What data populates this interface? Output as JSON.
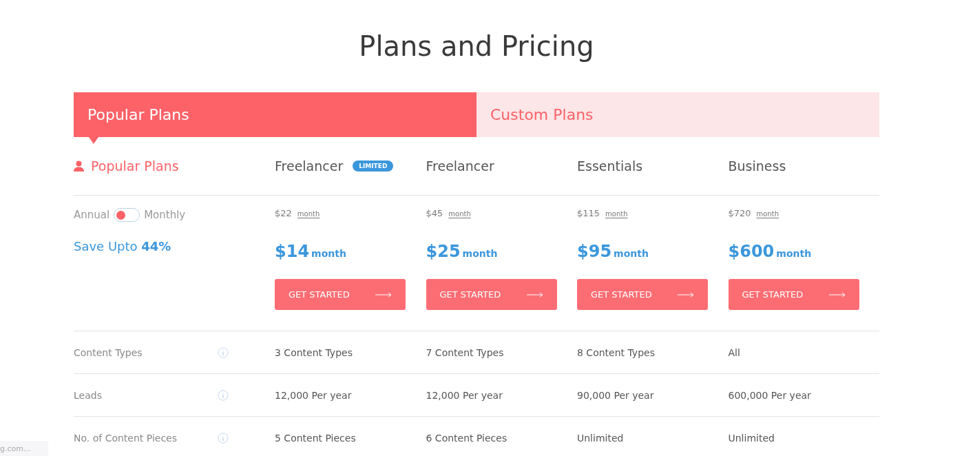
{
  "title": "Plans and Pricing",
  "tabs": [
    {
      "label": "Popular Plans",
      "selected": true
    },
    {
      "label": "Custom Plans",
      "selected": false
    }
  ],
  "section_heading": "Popular Plans",
  "billing": {
    "left_label": "Annual",
    "right_label": "Monthly",
    "on": false
  },
  "save_note": "Save Upto **44%**",
  "plans": [
    {
      "name": "Freelancer",
      "badge": "LIMITED",
      "old_price": "$22",
      "old_unit": "month",
      "price": "$14",
      "unit": "month",
      "button": "GET STARTED"
    },
    {
      "name": "Freelancer",
      "old_price": "$45",
      "old_unit": "month",
      "price": "$25",
      "unit": "month",
      "button": "GET STARTED"
    },
    {
      "name": "Essentials",
      "old_price": "$115",
      "old_unit": "month",
      "price": "$95",
      "unit": "month",
      "button": "GET STARTED"
    },
    {
      "name": "Business",
      "old_price": "$720",
      "old_unit": "month",
      "price": "$600",
      "unit": "month",
      "button": "GET STARTED"
    }
  ],
  "features": [
    {
      "label": "Content Types",
      "values": [
        "3 Content Types",
        "7 Content Types",
        "8 Content Types",
        "All"
      ]
    },
    {
      "label": "Leads",
      "values": [
        "12,000 Per year",
        "12,000 Per year",
        "90,000 Per year",
        "600,000 Per year"
      ]
    },
    {
      "label": "No. of Content Pieces",
      "values": [
        "5 Content Pieces",
        "6 Content Pieces",
        "Unlimited",
        "Unlimited"
      ]
    }
  ],
  "status_bar": "g.com..."
}
